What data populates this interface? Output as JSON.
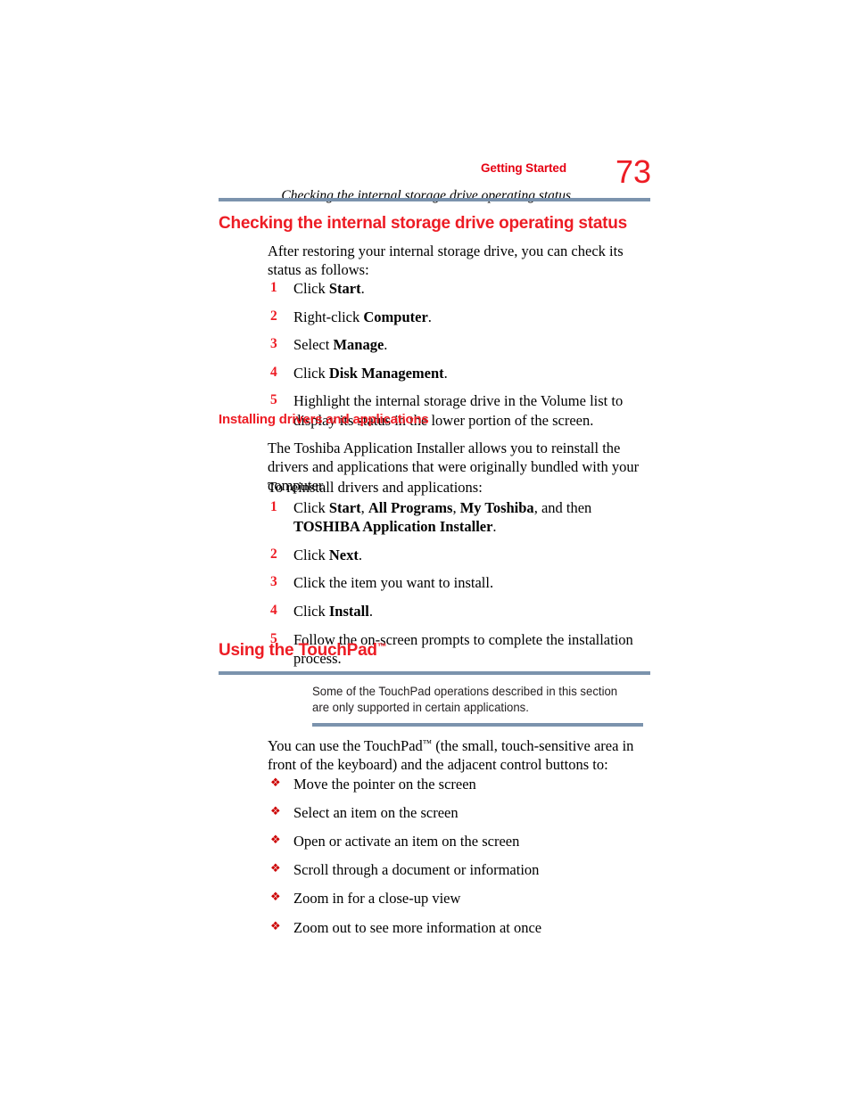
{
  "header": {
    "section_label": "Getting Started",
    "subject": "Checking the internal storage drive operating status",
    "page_number": "73",
    "accent_color": "#ed1c24",
    "rule_color": "#7b93ad"
  },
  "section_status": {
    "heading": "Checking the internal storage drive operating status",
    "intro": "After restoring your internal storage drive, you can check its status as follows:",
    "steps": [
      {
        "number": "1",
        "text_pre": "Click ",
        "bold": "Start",
        "text_post": "."
      },
      {
        "number": "2",
        "text_pre": "Right-click ",
        "bold": "Computer",
        "text_post": "."
      },
      {
        "number": "3",
        "text_pre": "Select ",
        "bold": "Manage",
        "text_post": "."
      },
      {
        "number": "4",
        "text_pre": "Click ",
        "bold": "Disk Management",
        "text_post": "."
      },
      {
        "number": "5",
        "text_pre": "Highlight the internal storage drive in the Volume list to display its status in the lower portion of the screen.",
        "bold": "",
        "text_post": ""
      }
    ]
  },
  "section_drivers": {
    "heading": "Installing drivers and applications",
    "paragraph": "The Toshiba Application Installer allows you to reinstall the drivers and applications that were originally bundled with your computer.",
    "lead_in": "To reinstall drivers and applications:",
    "steps": [
      {
        "number": "1",
        "text_pre": "Click ",
        "bold": "Start",
        "mid1": ", ",
        "bold2": "All Programs",
        "mid2": ", ",
        "bold3": "My Toshiba",
        "mid3": ", and then ",
        "bold4": "TOSHIBA Application Installer",
        "text_post": "."
      },
      {
        "number": "2",
        "text_pre": "Click ",
        "bold": "Next",
        "text_post": "."
      },
      {
        "number": "3",
        "text_pre": "Click the item you want to install.",
        "bold": "",
        "text_post": ""
      },
      {
        "number": "4",
        "text_pre": "Click ",
        "bold": "Install",
        "text_post": "."
      },
      {
        "number": "5",
        "text_pre": "Follow the on-screen prompts to complete the installation process.",
        "bold": "",
        "text_post": ""
      }
    ]
  },
  "section_touchpad": {
    "heading": "Using the TouchPad",
    "heading_tm": "™",
    "note": "Some of the TouchPad operations described in this section are only supported in certain applications.",
    "intro_pre": "You can use the TouchPad",
    "intro_tm": "™",
    "intro_post": " (the small, touch-sensitive area in front of the keyboard) and the adjacent control buttons to:",
    "bullet_glyph": "❖",
    "bullets": [
      "Move the pointer on the screen",
      "Select an item on the screen",
      "Open or activate an item on the screen",
      "Scroll through a document or information",
      "Zoom in for a close-up view",
      "Zoom out to see more information at once"
    ]
  }
}
